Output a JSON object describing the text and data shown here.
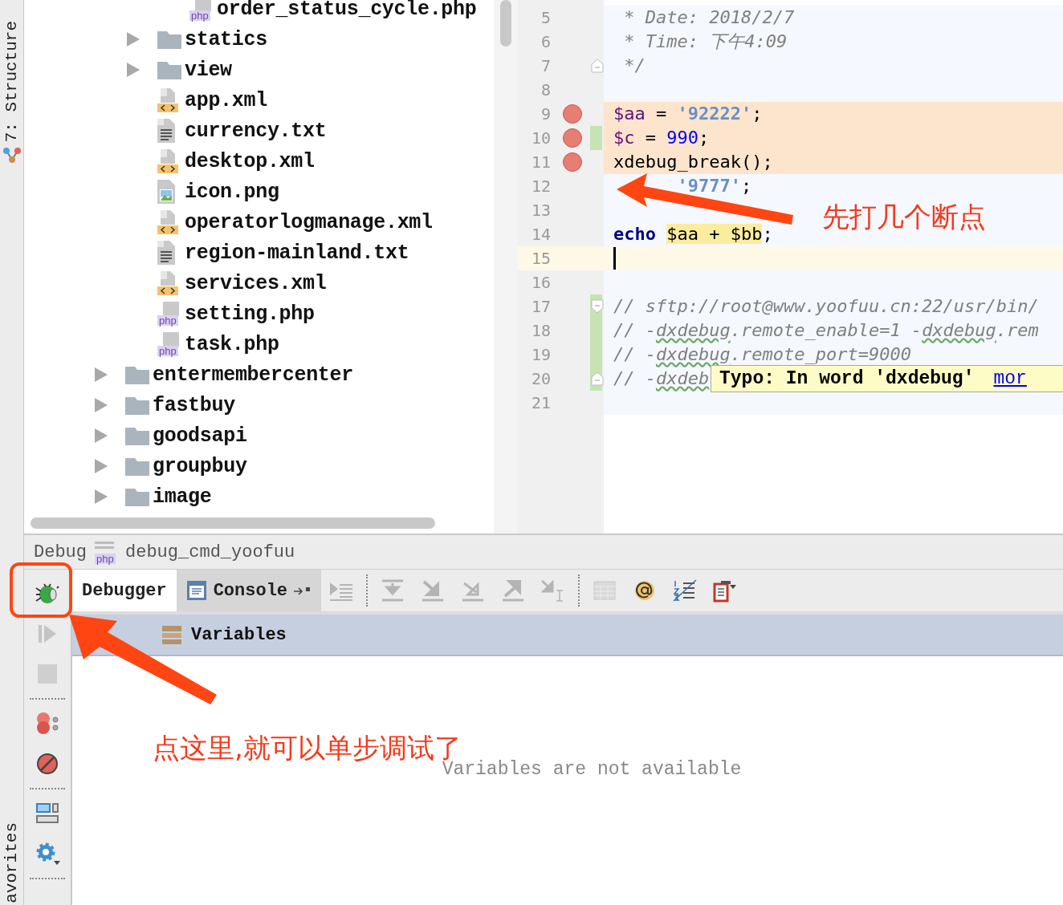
{
  "side_tabs": [
    {
      "label": "7: Structure"
    },
    {
      "label": "avorites"
    }
  ],
  "project_tree": [
    {
      "children": [
        {
          "children": [
            {
              "name": "order_status_cycle.php",
              "kind": "php",
              "badge": "php"
            }
          ]
        },
        {
          "name": "statics",
          "kind": "folder"
        },
        {
          "name": "view",
          "kind": "folder"
        },
        {
          "name": "app.xml",
          "kind": "xml"
        },
        {
          "name": "currency.txt",
          "kind": "txt"
        },
        {
          "name": "desktop.xml",
          "kind": "xml"
        },
        {
          "name": "icon.png",
          "kind": "png"
        },
        {
          "name": "operatorlogmanage.xml",
          "kind": "xml"
        },
        {
          "name": "region-mainland.txt",
          "kind": "txt"
        },
        {
          "name": "services.xml",
          "kind": "xml"
        },
        {
          "name": "setting.php",
          "kind": "php",
          "badge": "php"
        },
        {
          "name": "task.php",
          "kind": "php",
          "badge": "php"
        }
      ]
    },
    {
      "name": "entermembercenter",
      "kind": "folder"
    },
    {
      "name": "fastbuy",
      "kind": "folder"
    },
    {
      "name": "goodsapi",
      "kind": "folder"
    },
    {
      "name": "groupbuy",
      "kind": "folder"
    },
    {
      "name": "image",
      "kind": "folder"
    }
  ],
  "editor": {
    "lines": [
      {
        "number": "5",
        "breakpoint": false,
        "changed": false,
        "current": false,
        "tokens": [
          {
            "text": " * Date: 2018/2/7",
            "kind": "doc"
          }
        ]
      },
      {
        "number": "6",
        "breakpoint": false,
        "changed": false,
        "current": false,
        "tokens": [
          {
            "text": " * Time: 下午4:09",
            "kind": "doc"
          }
        ]
      },
      {
        "number": "7",
        "breakpoint": false,
        "changed": false,
        "current": false,
        "fold_end": true,
        "tokens": [
          {
            "text": " */",
            "kind": "doc"
          }
        ]
      },
      {
        "number": "8",
        "breakpoint": false,
        "changed": false,
        "current": false
      },
      {
        "number": "9",
        "breakpoint": true,
        "changed": false,
        "current": false,
        "tokens": [
          {
            "text": "$aa",
            "kind": "var"
          },
          {
            "text": " = ",
            "kind": "plain"
          },
          {
            "text": "'92222'",
            "kind": "string"
          },
          {
            "text": ";",
            "kind": "plain"
          }
        ]
      },
      {
        "number": "10",
        "breakpoint": true,
        "changed": true,
        "current": false,
        "tokens": [
          {
            "text": "$c",
            "kind": "var"
          },
          {
            "text": " = ",
            "kind": "plain"
          },
          {
            "text": "990",
            "kind": "number"
          },
          {
            "text": ";",
            "kind": "plain"
          }
        ]
      },
      {
        "number": "11",
        "breakpoint": true,
        "changed": false,
        "current": false,
        "tokens": [
          {
            "text": "xdebug_break();",
            "kind": "plain"
          }
        ]
      },
      {
        "number": "12",
        "breakpoint": false,
        "changed": false,
        "current": false,
        "tokens": [
          {
            "text": "      '9777'",
            "kind": "string"
          },
          {
            "text": ";",
            "kind": "plain"
          }
        ]
      },
      {
        "number": "13",
        "breakpoint": false,
        "changed": false,
        "current": false
      },
      {
        "number": "14",
        "breakpoint": false,
        "changed": false,
        "current": false,
        "tokens": [
          {
            "text": "echo ",
            "kind": "keyword"
          },
          {
            "text": "$aa + $bb",
            "kind": "usage"
          },
          {
            "text": ";",
            "kind": "plain"
          }
        ]
      },
      {
        "number": "15",
        "breakpoint": false,
        "changed": false,
        "current": true
      },
      {
        "number": "16",
        "breakpoint": false,
        "changed": false,
        "current": false
      },
      {
        "number": "17",
        "breakpoint": false,
        "changed": true,
        "current": false,
        "fold_start": true,
        "tokens": [
          {
            "text": "// sftp://root@www.yoofuu.cn:22/usr/bin/",
            "kind": "comment"
          }
        ]
      },
      {
        "number": "18",
        "breakpoint": false,
        "changed": true,
        "current": false,
        "tokens": [
          {
            "text": "// -",
            "kind": "comment"
          },
          {
            "text": "dxdebug",
            "kind": "typo"
          },
          {
            "text": ".remote_enable=1 -",
            "kind": "comment"
          },
          {
            "text": "dxdebug",
            "kind": "typo"
          },
          {
            "text": ".rem",
            "kind": "comment"
          }
        ]
      },
      {
        "number": "19",
        "breakpoint": false,
        "changed": true,
        "current": false,
        "tokens": [
          {
            "text": "// -",
            "kind": "comment"
          },
          {
            "text": "dxdebug",
            "kind": "typo"
          },
          {
            "text": ".remote_port=9000",
            "kind": "comment"
          }
        ]
      },
      {
        "number": "20",
        "breakpoint": false,
        "changed": true,
        "current": false,
        "fold_end": true,
        "tokens": [
          {
            "text": "// -",
            "kind": "comment"
          },
          {
            "text": "dxdeb",
            "kind": "typo"
          }
        ]
      },
      {
        "number": "21",
        "breakpoint": false,
        "changed": false,
        "current": false
      }
    ],
    "tooltip": {
      "text": "Typo: In word 'dxdebug'",
      "link": "mor"
    }
  },
  "debug": {
    "title": "Debug",
    "config": "debug_cmd_yoofuu",
    "config_badge": "php",
    "tabs": [
      {
        "label": "Debugger",
        "selected": true
      },
      {
        "label": "Console",
        "selected": false
      }
    ],
    "toolbar": [
      {
        "kind": "show-execution-point",
        "disabled": true
      },
      {
        "kind": "separator"
      },
      {
        "kind": "step-over",
        "disabled": true
      },
      {
        "kind": "step-into",
        "disabled": true
      },
      {
        "kind": "force-step-into",
        "disabled": true
      },
      {
        "kind": "step-out",
        "disabled": true
      },
      {
        "kind": "run-to-cursor",
        "disabled": true
      },
      {
        "kind": "separator"
      },
      {
        "kind": "evaluate",
        "disabled": true
      },
      {
        "kind": "watch",
        "disabled": false
      },
      {
        "kind": "line-numbers",
        "disabled": false
      },
      {
        "kind": "restore-layout",
        "disabled": false
      }
    ],
    "side_toolbar": [
      {
        "kind": "debug",
        "disabled": false
      },
      {
        "kind": "resume",
        "disabled": true
      },
      {
        "kind": "stop",
        "disabled": true
      },
      {
        "kind": "separator"
      },
      {
        "kind": "view-breakpoints",
        "disabled": false
      },
      {
        "kind": "mute-breakpoints",
        "disabled": false
      },
      {
        "kind": "separator"
      },
      {
        "kind": "layout",
        "disabled": false
      },
      {
        "kind": "settings",
        "disabled": false
      },
      {
        "kind": "separator"
      }
    ],
    "variables": {
      "title": "Variables",
      "empty_text": "Variables are not available"
    }
  },
  "annotations": [
    {
      "text": "先打几个断点"
    },
    {
      "text": "点这里,就可以单步调试了"
    }
  ]
}
